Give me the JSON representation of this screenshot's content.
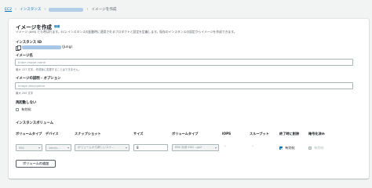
{
  "breadcrumb": {
    "service": "EC2",
    "instances": "インスタンス",
    "current": "イメージを作成"
  },
  "page": {
    "title": "イメージを作成",
    "info_link": "情報",
    "description": "イメージ (AMI) とも呼ばれます。EC2 インスタンスの起動時に適用されるプロダクトと設定を定義します。既存のインスタンスの設定からイメージを作成できます。"
  },
  "instance_id": {
    "label": "インスタンス ID",
    "suffix": "(Jung)"
  },
  "image_name": {
    "label": "イメージ名",
    "placeholder": "Enter image name",
    "hint": "最大 127 文字。作成後に変更することはできません。"
  },
  "image_description": {
    "label": "イメージの説明 - オプション",
    "placeholder": "Image description",
    "hint": "最大 255 文字"
  },
  "no_reboot": {
    "label": "再起動しない",
    "option": "有効化",
    "checked": false
  },
  "volumes": {
    "section_label": "インスタンスボリューム",
    "headers": {
      "volume_type": "ボリュームタイプ",
      "device": "デバイス",
      "snapshot": "スナップショット",
      "size": "サイズ",
      "type": "ボリュームタイプ",
      "iops": "IOPS",
      "throughput": "スループット",
      "delete_on_termination": "終了時に削除",
      "encrypted": "暗号化済み"
    },
    "row": {
      "volume_type": "EBS",
      "device": "/dev/x...",
      "snapshot": "ボリュームから新しいスナ...",
      "size": "8",
      "type": "EBS 汎用 SSD - gp2",
      "iops": "-",
      "throughput": "-",
      "delete_on_termination_label": "有効化",
      "delete_on_termination": true,
      "encrypted_label": "有効化",
      "encrypted": false
    },
    "add_button": "ボリュームの追加"
  }
}
